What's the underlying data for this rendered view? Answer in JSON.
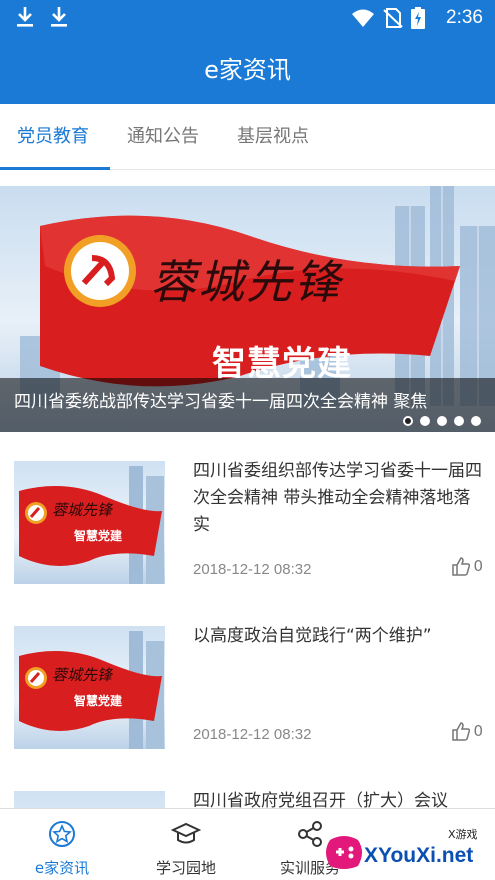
{
  "status_bar": {
    "time": "2:36"
  },
  "app_bar": {
    "title": "e家资讯"
  },
  "tabs": [
    {
      "label": "党员教育",
      "active": true
    },
    {
      "label": "通知公告",
      "active": false
    },
    {
      "label": "基层视点",
      "active": false
    }
  ],
  "banner": {
    "caption": "四川省委统战部传达学习省委十一届四次全会精神 聚焦",
    "image_text_1": "蓉城先锋",
    "image_text_2": "智慧党建",
    "slide_count": 5,
    "active_slide": 1
  },
  "articles": [
    {
      "title": "四川省委组织部传达学习省委十一届四次全会精神 带头推动全会精神落地落实",
      "time": "2018-12-12 08:32",
      "likes": "0"
    },
    {
      "title": "以高度政治自觉践行“两个维护”",
      "time": "2018-12-12 08:32",
      "likes": "0"
    },
    {
      "title": "四川省政府党组召开（扩大）会议",
      "time": "",
      "likes": ""
    }
  ],
  "thumb_text": {
    "line1": "蓉城先锋",
    "line2": "智慧党建"
  },
  "bottom_nav": [
    {
      "label": "e家资讯",
      "icon": "star-badge-icon",
      "active": true
    },
    {
      "label": "学习园地",
      "icon": "graduation-cap-icon",
      "active": false
    },
    {
      "label": "实训服务",
      "icon": "share-icon",
      "active": false
    }
  ],
  "watermark": {
    "text": "XYouXi.net",
    "small": "X游戏"
  },
  "colors": {
    "primary": "#1a7ad6",
    "flag_red": "#d81e1e"
  }
}
